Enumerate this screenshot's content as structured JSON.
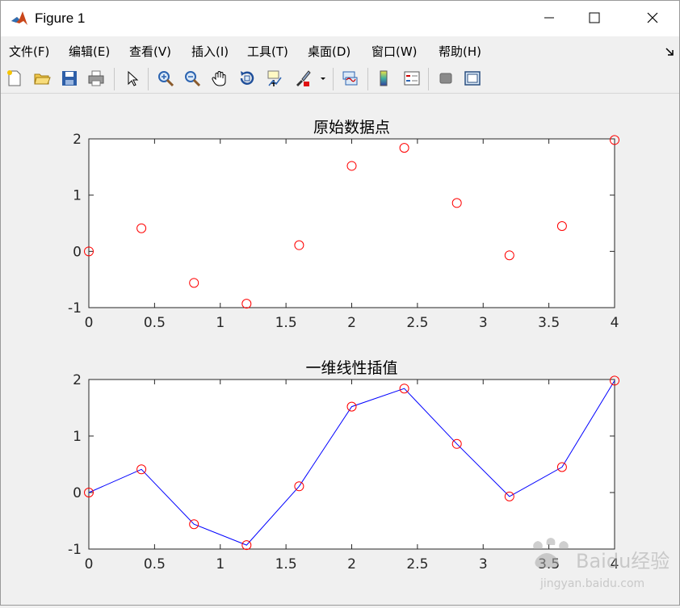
{
  "window": {
    "title": "Figure 1"
  },
  "menu": [
    "文件(F)",
    "编辑(E)",
    "查看(V)",
    "插入(I)",
    "工具(T)",
    "桌面(D)",
    "窗口(W)",
    "帮助(H)"
  ],
  "toolbar": [
    "new-icon",
    "open-icon",
    "save-icon",
    "print-icon",
    "pointer-icon",
    "zoom-in-icon",
    "zoom-out-icon",
    "pan-icon",
    "rotate-3d-icon",
    "data-cursor-icon",
    "brush-icon",
    "link-icon",
    "colorbar-icon",
    "legend-icon",
    "hide-plot-tools-icon",
    "show-plot-tools-icon"
  ],
  "chart_data": [
    {
      "type": "scatter",
      "title": "原始数据点",
      "xlim": [
        0,
        4
      ],
      "ylim": [
        -1,
        2
      ],
      "xticks": [
        "0",
        "0.5",
        "1",
        "1.5",
        "2",
        "2.5",
        "3",
        "3.5",
        "4"
      ],
      "yticks": [
        "-1",
        "0",
        "1",
        "2"
      ],
      "x": [
        0,
        0.4,
        0.8,
        1.2,
        1.6,
        2.0,
        2.4,
        2.8,
        3.2,
        3.6,
        4.0
      ],
      "y": [
        0,
        0.41,
        -0.56,
        -0.93,
        0.11,
        1.52,
        1.84,
        0.86,
        -0.07,
        0.45,
        1.98
      ],
      "marker_color": "#ff0000"
    },
    {
      "type": "line",
      "title": "一维线性插值",
      "xlim": [
        0,
        4
      ],
      "ylim": [
        -1,
        2
      ],
      "xticks": [
        "0",
        "0.5",
        "1",
        "1.5",
        "2",
        "2.5",
        "3",
        "3.5",
        "4"
      ],
      "yticks": [
        "-1",
        "0",
        "1",
        "2"
      ],
      "x": [
        0,
        0.4,
        0.8,
        1.2,
        1.6,
        2.0,
        2.4,
        2.8,
        3.2,
        3.6,
        4.0
      ],
      "y": [
        0,
        0.41,
        -0.56,
        -0.93,
        0.11,
        1.52,
        1.84,
        0.86,
        -0.07,
        0.45,
        1.98
      ],
      "line_color": "#0000ff",
      "marker_color": "#ff0000"
    }
  ],
  "watermark": {
    "brand": "Baidu经验",
    "url": "jingyan.baidu.com"
  }
}
